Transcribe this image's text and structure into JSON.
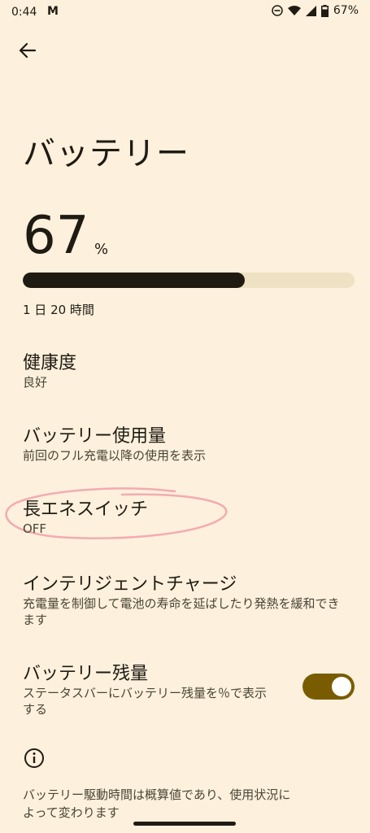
{
  "status_bar": {
    "time": "0:44",
    "notification_letter": "M",
    "battery": "67%"
  },
  "header": {
    "title": "バッテリー"
  },
  "battery": {
    "percent": "67",
    "percent_unit": "%",
    "level_fraction": 0.67,
    "time_remaining": "1 日 20 時間"
  },
  "settings": [
    {
      "title": "健康度",
      "subtitle": "良好"
    },
    {
      "title": "バッテリー使用量",
      "subtitle": "前回のフル充電以降の使用を表示"
    },
    {
      "title": "長エネスイッチ",
      "subtitle": "OFF"
    },
    {
      "title": "インテリジェントチャージ",
      "subtitle": "充電量を制御して電池の寿命を延ばしたり発熱を緩和できます"
    },
    {
      "title": "バッテリー残量",
      "subtitle": "ステータスバーにバッテリー残量を％で表示する",
      "toggle_on": true
    }
  ],
  "footer": {
    "info_text": "バッテリー駆動時間は概算値であり、使用状況によって変わります"
  },
  "colors": {
    "background": "#fdf0dc",
    "accent": "#7a5c00",
    "highlight": "#f0a0a8"
  }
}
